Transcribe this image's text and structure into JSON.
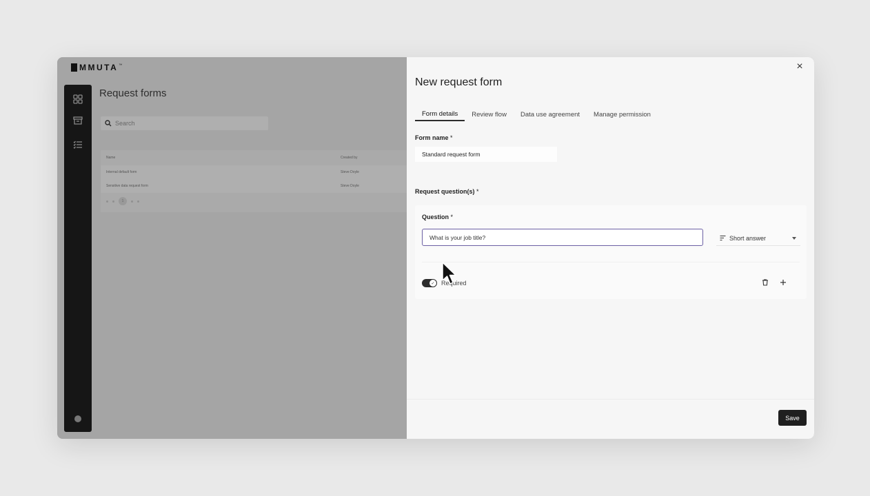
{
  "app": {
    "logo_text": "MMUTA",
    "logo_tm": "™",
    "page_title": "Request forms",
    "search_placeholder": "Search",
    "table": {
      "headers": [
        "Name",
        "Created by"
      ],
      "rows": [
        [
          "Internal default form",
          "Steve Doyle"
        ],
        [
          "Sensitive data request form",
          "Steve Doyle"
        ]
      ],
      "page_number": "1"
    }
  },
  "panel": {
    "title": "New request form",
    "tabs": [
      {
        "label": "Form details",
        "active": true
      },
      {
        "label": "Review flow",
        "active": false
      },
      {
        "label": "Data use agreement",
        "active": false
      },
      {
        "label": "Manage permission",
        "active": false
      }
    ],
    "form_name_label": "Form name",
    "form_name_value": "Standard request form",
    "required_marker": "*",
    "request_questions_label": "Request question(s)",
    "question": {
      "label": "Question",
      "value": "What is your job title?",
      "type": "Short answer",
      "required_label": "Required",
      "required_on": true
    },
    "save_label": "Save",
    "close_label": "×"
  },
  "colors": {
    "focus_border": "#6b5fa3",
    "primary_button": "#1f1f1f",
    "sidebar": "#161616"
  }
}
